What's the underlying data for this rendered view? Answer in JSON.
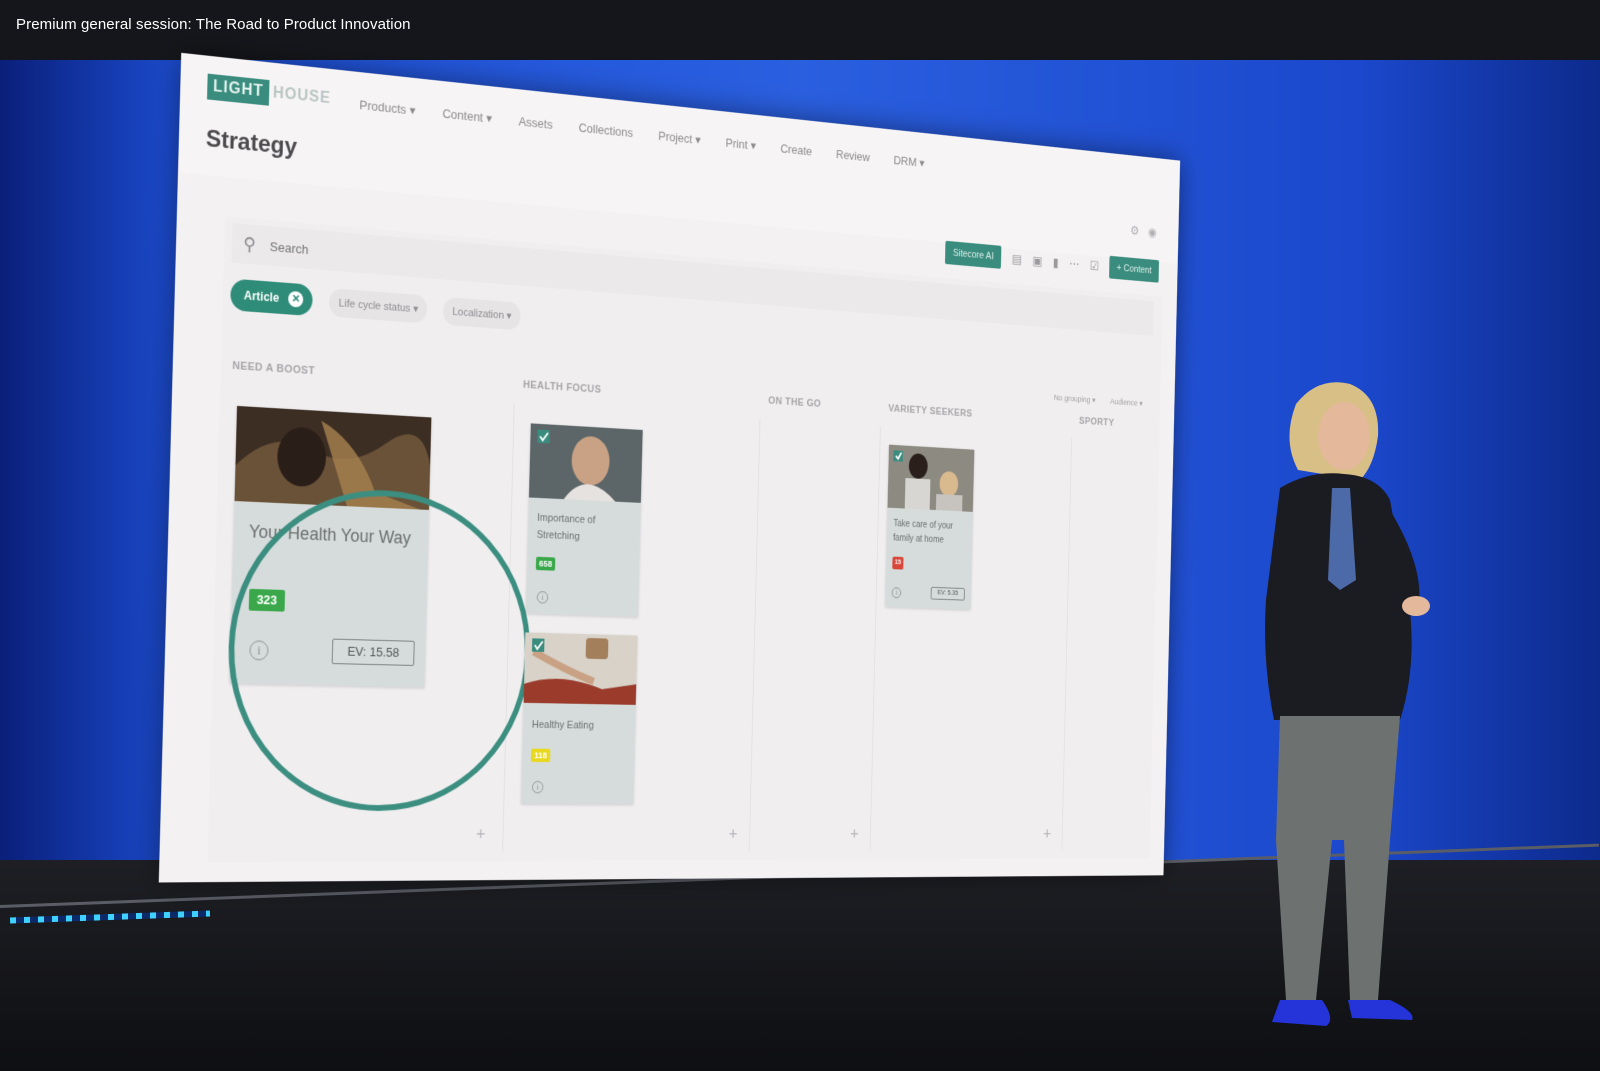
{
  "session": {
    "title": "Premium general session: The Road to Product Innovation"
  },
  "app": {
    "logo_part1": "LIGHT",
    "logo_part2": "HOUSE",
    "nav": [
      "Products ▾",
      "Content ▾",
      "Assets",
      "Collections",
      "Project ▾",
      "Print ▾",
      "Create",
      "Review",
      "DRM ▾"
    ],
    "page_title": "Strategy",
    "toolbar": {
      "sitecore_label": "Sitecore AI",
      "content_label": "+ Content"
    },
    "search": {
      "placeholder": "Search"
    },
    "filters": {
      "active_chip": "Article",
      "chip_lifecycle": "Life cycle status ▾",
      "chip_localization": "Localization ▾"
    },
    "view_options": {
      "grouping": "No grouping ▾",
      "audience": "Audience ▾"
    },
    "columns": [
      "NEED A BOOST",
      "HEALTH FOCUS",
      "ON THE GO",
      "VARIETY SEEKERS",
      "SPORTY"
    ],
    "cards": [
      {
        "title": "Your Health Your Way",
        "score": "323",
        "score_color": "#3aa84a",
        "ev": "EV: 15.58"
      },
      {
        "title": "Importance of Stretching",
        "score": "658",
        "score_color": "#3aa84a"
      },
      {
        "title": "Healthy Eating",
        "score": "118",
        "score_color": "#e8d81e"
      },
      {
        "title": "Take care of your family at home",
        "score": "15",
        "score_color": "#d9473a",
        "ev": "EV: 5.35"
      }
    ],
    "colors": {
      "accent": "#3a8c7e",
      "highlight_ring": "#3b8e80"
    }
  }
}
